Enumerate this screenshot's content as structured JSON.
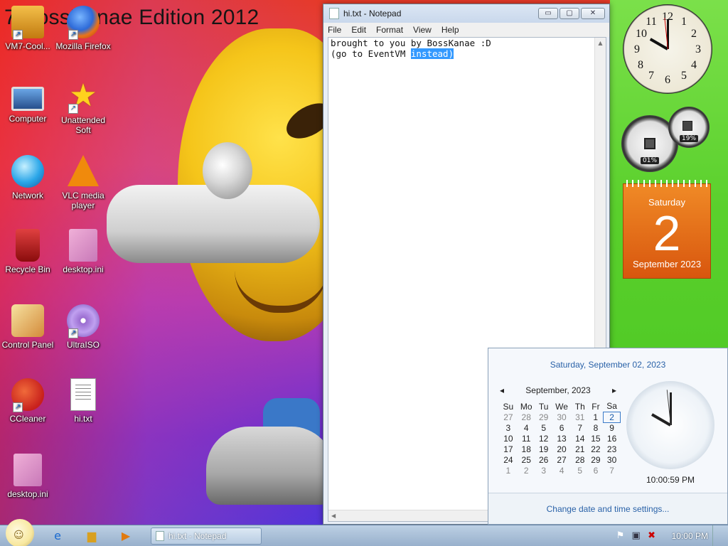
{
  "desktop": {
    "watermark": "7 BossKanae Edition 2012",
    "icons": [
      {
        "label": "VM7-Cool..."
      },
      {
        "label": "Mozilla Firefox"
      },
      {
        "label": "Computer"
      },
      {
        "label": "Unattended Soft"
      },
      {
        "label": "Network"
      },
      {
        "label": "VLC media player"
      },
      {
        "label": "Recycle Bin"
      },
      {
        "label": "desktop.ini"
      },
      {
        "label": "Control Panel"
      },
      {
        "label": "UltraISO"
      },
      {
        "label": "CCleaner"
      },
      {
        "label": "hi.txt"
      },
      {
        "label": "desktop.ini"
      }
    ]
  },
  "notepad": {
    "title": "hi.txt - Notepad",
    "menu": [
      "File",
      "Edit",
      "Format",
      "View",
      "Help"
    ],
    "line1": "brought to you by BossKanae :D",
    "line2_pre": "(go to EventVM ",
    "line2_sel": "instead)",
    "minimize": "▭",
    "maximize": "▢",
    "close": "✕"
  },
  "gadgets": {
    "clock_numbers": [
      "12",
      "1",
      "2",
      "3",
      "4",
      "5",
      "6",
      "7",
      "8",
      "9",
      "10",
      "11"
    ],
    "cpu_percent": "01%",
    "mem_percent": "19%",
    "calendar": {
      "day": "Saturday",
      "date": "2",
      "month": "September 2023"
    }
  },
  "datetime_popup": {
    "header": "Saturday, September 02, 2023",
    "month_label": "September, 2023",
    "prev": "◂",
    "next": "▸",
    "weekdays": [
      "Su",
      "Mo",
      "Tu",
      "We",
      "Th",
      "Fr",
      "Sa"
    ],
    "weeks": [
      [
        "27",
        "28",
        "29",
        "30",
        "31",
        "1",
        "2"
      ],
      [
        "3",
        "4",
        "5",
        "6",
        "7",
        "8",
        "9"
      ],
      [
        "10",
        "11",
        "12",
        "13",
        "14",
        "15",
        "16"
      ],
      [
        "17",
        "18",
        "19",
        "20",
        "21",
        "22",
        "23"
      ],
      [
        "24",
        "25",
        "26",
        "27",
        "28",
        "29",
        "30"
      ],
      [
        "1",
        "2",
        "3",
        "4",
        "5",
        "6",
        "7"
      ]
    ],
    "time": "10:00:59 PM",
    "link": "Change date and time settings..."
  },
  "taskbar": {
    "task": "hi.txt - Notepad",
    "clock": "10:00 PM"
  },
  "colors": {
    "accent": "#2a62a8",
    "selection": "#3399ff",
    "calendar_gadget": "#e8701a"
  }
}
